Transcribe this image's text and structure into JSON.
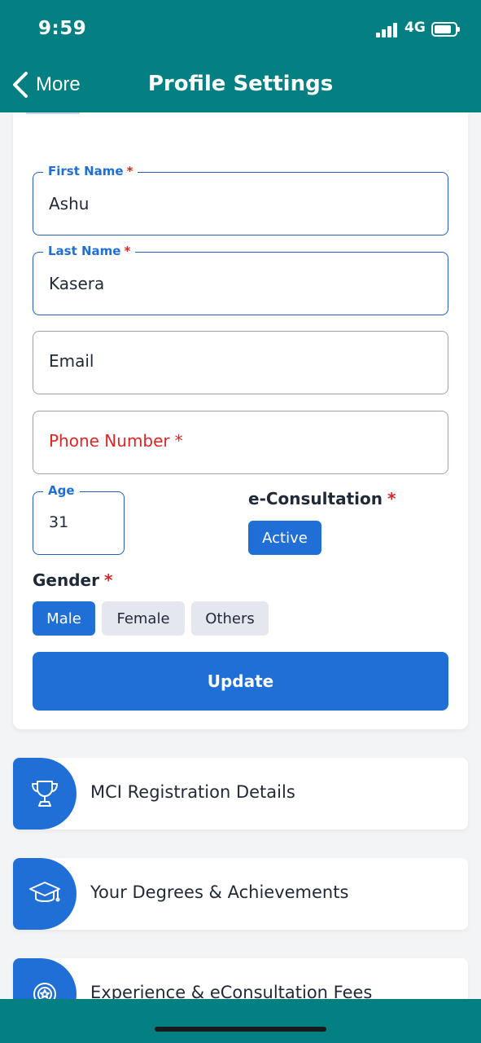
{
  "status": {
    "time": "9:59",
    "network": "4G"
  },
  "nav": {
    "back_label": "More",
    "title": "Profile Settings"
  },
  "form": {
    "first_name": {
      "label": "First Name",
      "required": "*",
      "value": "Ashu"
    },
    "last_name": {
      "label": "Last Name",
      "required": "*",
      "value": "Kasera"
    },
    "email": {
      "placeholder": "Email"
    },
    "phone": {
      "placeholder": "Phone Number",
      "required": "*"
    },
    "age": {
      "label": "Age",
      "value": "31"
    },
    "econsultation": {
      "label": "e-Consultation",
      "required": "*",
      "status": "Active"
    },
    "gender": {
      "label": "Gender",
      "required": "*",
      "options": [
        "Male",
        "Female",
        "Others"
      ],
      "selected": "Male"
    },
    "update_label": "Update"
  },
  "sections": [
    {
      "label": "MCI Registration Details",
      "icon": "trophy-icon"
    },
    {
      "label": "Your Degrees & Achievements",
      "icon": "graduation-cap-icon"
    },
    {
      "label": "Experience & eConsultation Fees",
      "icon": "medal-icon"
    }
  ],
  "colors": {
    "teal": "#047f82",
    "primary": "#1f6fd6",
    "required": "#e02424"
  }
}
